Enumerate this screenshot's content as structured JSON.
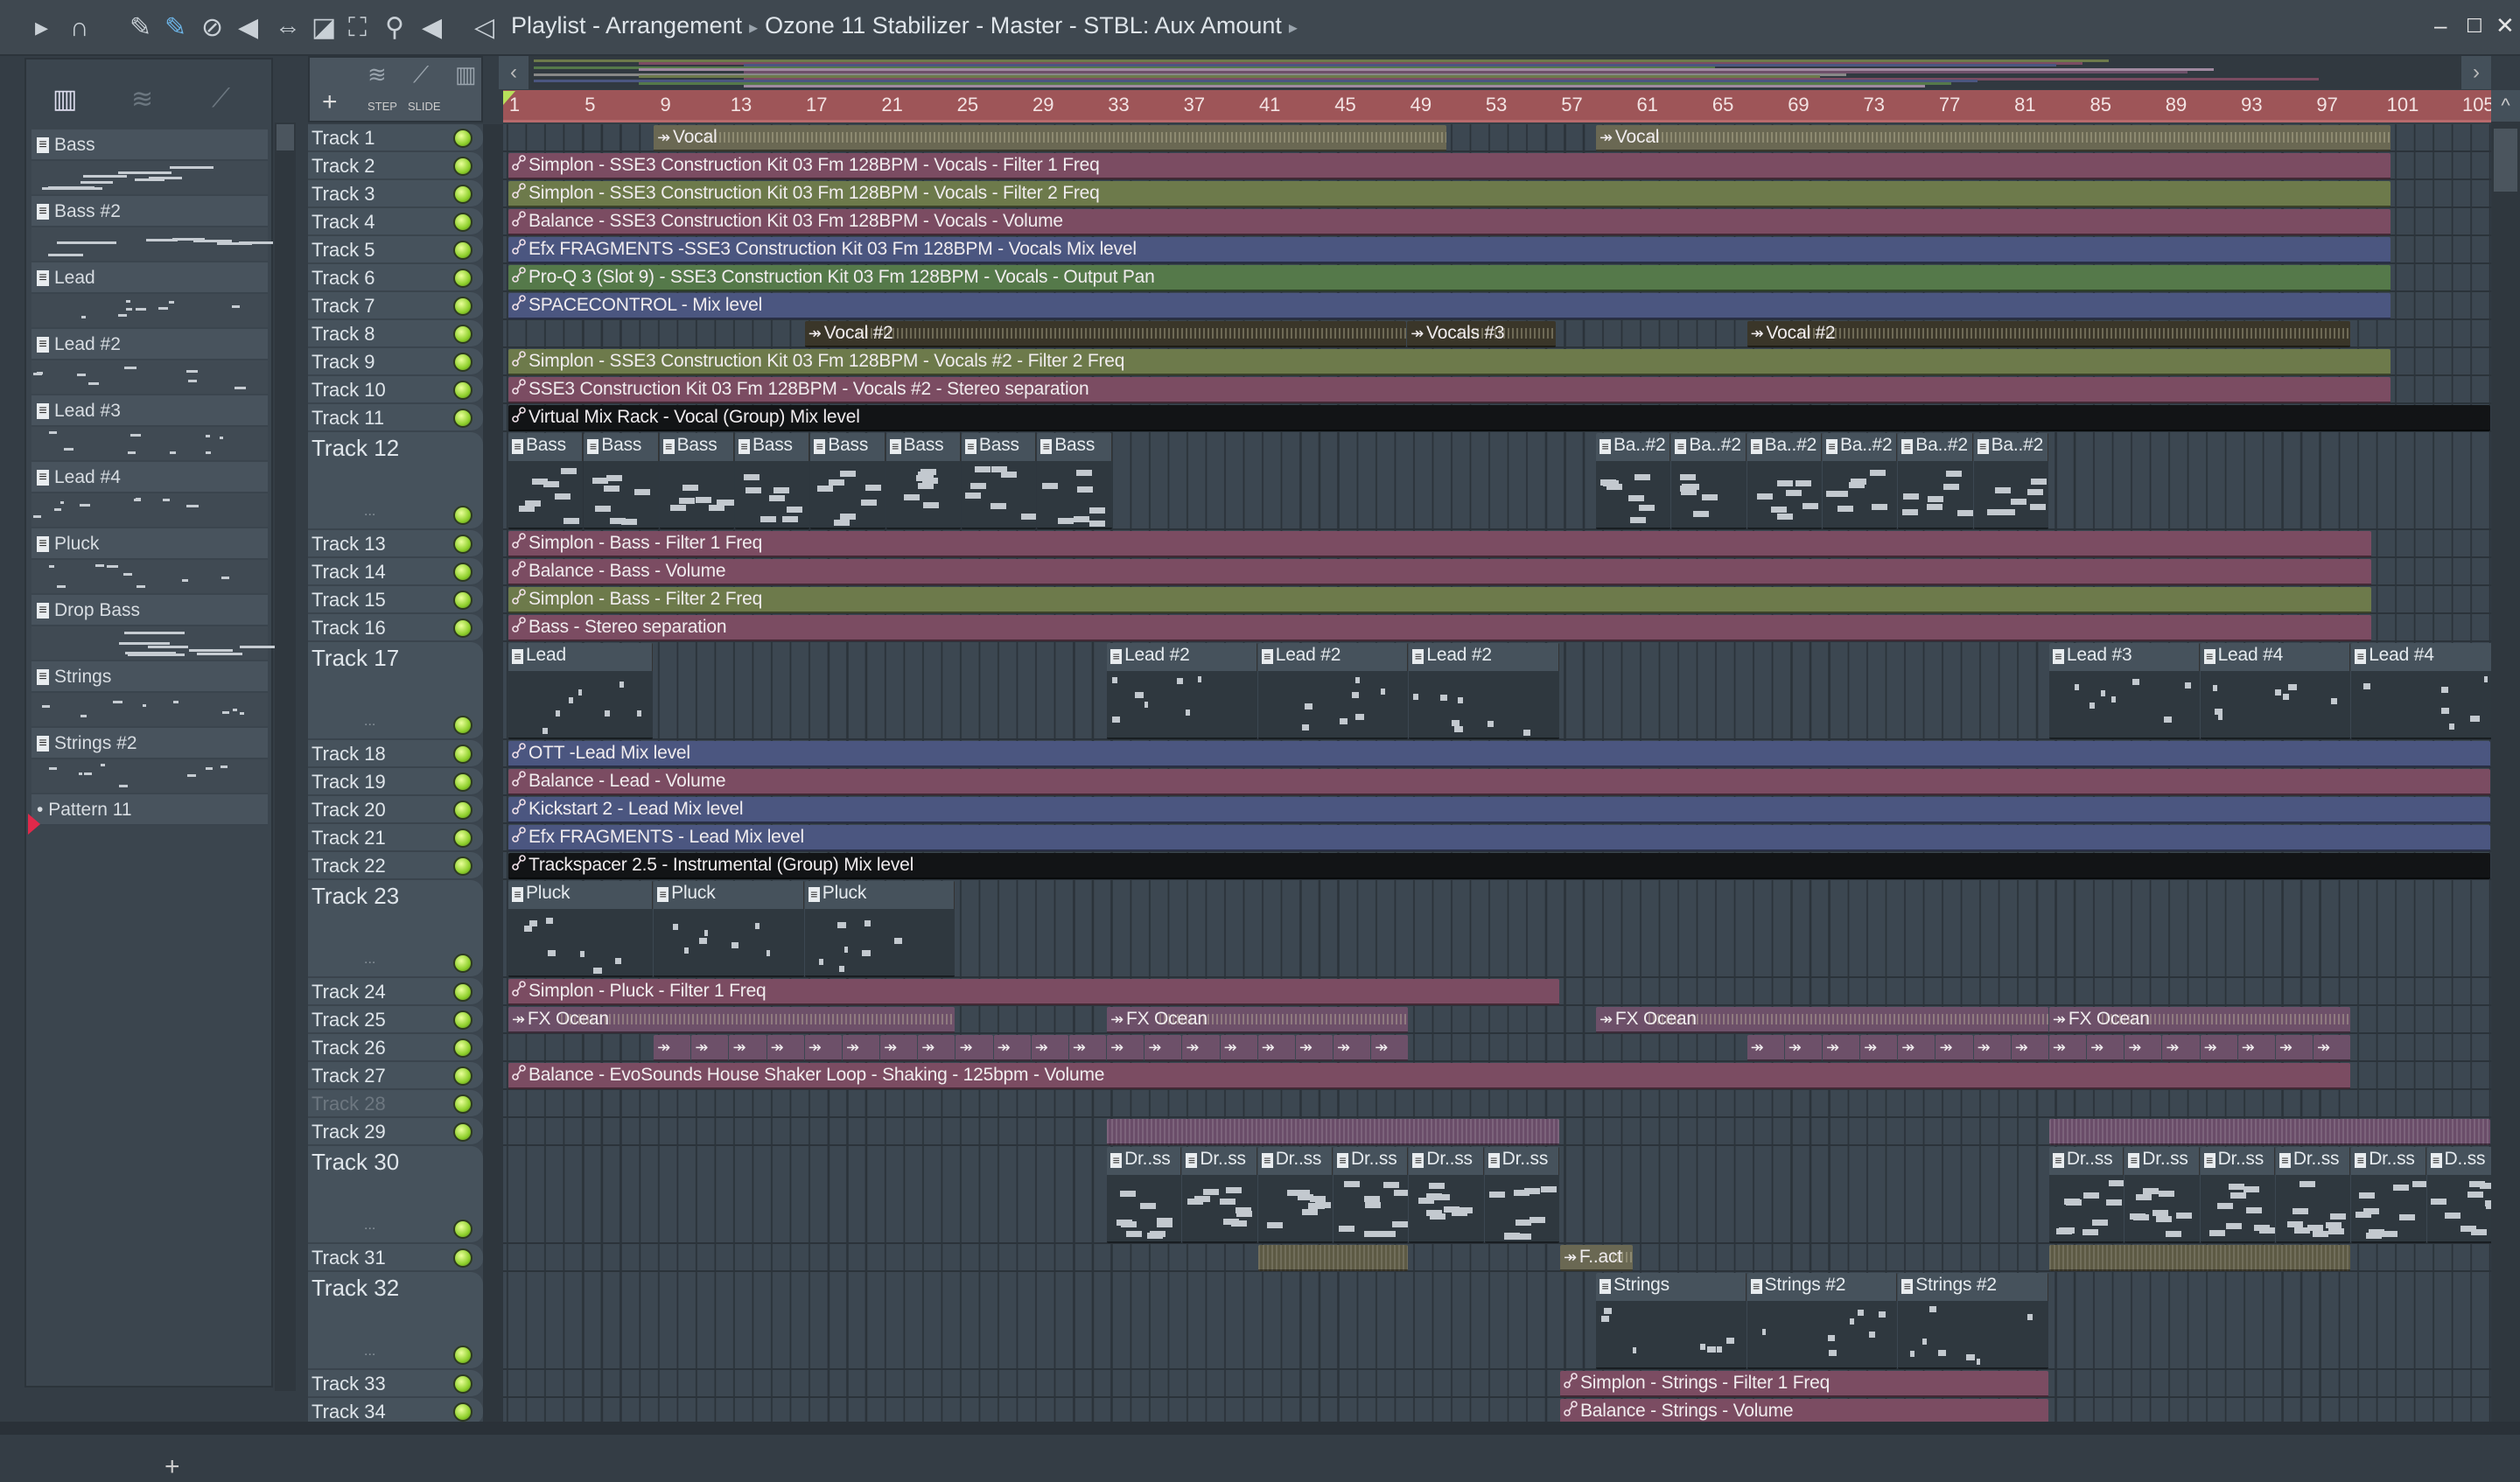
{
  "window": {
    "title": "Playlist - Arrangement",
    "breadcrumb": "Ozone 11 Stabilizer - Master - STBL: Aux Amount",
    "minimize": "‒",
    "maximize": "☐",
    "close": "✕"
  },
  "toolbar": {
    "icons": [
      {
        "name": "play-icon",
        "glyph": "▸"
      },
      {
        "name": "magnet-snap-icon",
        "glyph": "∩"
      },
      {
        "name": "pencil-draw-icon",
        "glyph": "✎"
      },
      {
        "name": "paint-brush-icon",
        "glyph": "✎"
      },
      {
        "name": "delete-icon",
        "glyph": "⊘"
      },
      {
        "name": "mute-icon",
        "glyph": "◀"
      },
      {
        "name": "slip-icon",
        "glyph": "⇔"
      },
      {
        "name": "slice-icon",
        "glyph": "◪"
      },
      {
        "name": "select-icon",
        "glyph": "⛶"
      },
      {
        "name": "zoom-icon",
        "glyph": "⚲"
      },
      {
        "name": "playback-icon",
        "glyph": "◀"
      },
      {
        "name": "speaker-icon",
        "glyph": "◁"
      }
    ]
  },
  "panel": {
    "add_label": "+",
    "step_label": "STEP",
    "slide_label": "SLIDE",
    "pattern_add_label": "+"
  },
  "patterns": [
    {
      "name": "Bass"
    },
    {
      "name": "Bass #2"
    },
    {
      "name": "Lead"
    },
    {
      "name": "Lead #2"
    },
    {
      "name": "Lead #3"
    },
    {
      "name": "Lead #4"
    },
    {
      "name": "Pluck"
    },
    {
      "name": "Drop Bass"
    },
    {
      "name": "Strings"
    },
    {
      "name": "Strings #2"
    },
    {
      "name": "Pattern 11",
      "current": true
    }
  ],
  "ruler": {
    "bars": [
      "1",
      "5",
      "9",
      "13",
      "17",
      "21",
      "25",
      "29",
      "33",
      "37",
      "41",
      "45",
      "49",
      "53",
      "57",
      "61",
      "65",
      "69",
      "73",
      "77",
      "81",
      "85",
      "89",
      "93",
      "97",
      "101",
      "105"
    ]
  },
  "colors": {
    "pink": "#7b4c62",
    "olive": "#6d7a4b",
    "blue": "#4b5680",
    "green": "#55794a",
    "black": "#121416",
    "vocal": "#6a6853",
    "vocaldark": "#3a3629",
    "fx": "#6d5069",
    "stripe": "#6a4d69",
    "ticks": "#5d5a44",
    "pattern": "#2f383f"
  },
  "tracks": [
    {
      "name": "Track 1",
      "clips": [
        {
          "s": 8.7,
          "e": 50.7,
          "kind": "audio",
          "color": "vocal",
          "label": "Vocal"
        },
        {
          "s": 58.6,
          "e": 100.7,
          "kind": "audio",
          "color": "vocal",
          "label": "Vocal"
        }
      ]
    },
    {
      "name": "Track 2",
      "clips": [
        {
          "s": 1,
          "e": 100.7,
          "kind": "auto",
          "color": "pink",
          "label": "Simplon - SSE3 Construction Kit 03 Fm 128BPM - Vocals - Filter 1 Freq"
        }
      ]
    },
    {
      "name": "Track 3",
      "clips": [
        {
          "s": 1,
          "e": 100.7,
          "kind": "auto",
          "color": "olive",
          "label": "Simplon - SSE3 Construction Kit 03 Fm 128BPM - Vocals - Filter 2 Freq"
        }
      ]
    },
    {
      "name": "Track 4",
      "clips": [
        {
          "s": 1,
          "e": 100.7,
          "kind": "auto",
          "color": "pink",
          "label": "Balance - SSE3 Construction Kit 03 Fm 128BPM - Vocals - Volume"
        }
      ]
    },
    {
      "name": "Track 5",
      "clips": [
        {
          "s": 1,
          "e": 100.7,
          "kind": "auto",
          "color": "blue",
          "label": "Efx FRAGMENTS -SSE3 Construction Kit 03 Fm 128BPM - Vocals Mix level"
        }
      ]
    },
    {
      "name": "Track 6",
      "clips": [
        {
          "s": 1,
          "e": 100.7,
          "kind": "auto",
          "color": "green",
          "label": "Pro-Q 3 (Slot 9) - SSE3 Construction Kit 03 Fm 128BPM - Vocals - Output Pan"
        }
      ]
    },
    {
      "name": "Track 7",
      "clips": [
        {
          "s": 1,
          "e": 100.7,
          "kind": "auto",
          "color": "blue",
          "label": "SPACECONTROL - Mix level"
        }
      ]
    },
    {
      "name": "Track 8",
      "clips": [
        {
          "s": 16.7,
          "e": 48.6,
          "kind": "audio",
          "color": "vocaldark",
          "label": "Vocal #2"
        },
        {
          "s": 48.6,
          "e": 56.5,
          "kind": "audio",
          "color": "vocaldark",
          "label": "Vocals #3"
        },
        {
          "s": 66.6,
          "e": 98.6,
          "kind": "audio",
          "color": "vocaldark",
          "label": "Vocal #2"
        }
      ]
    },
    {
      "name": "Track 9",
      "clips": [
        {
          "s": 1,
          "e": 100.7,
          "kind": "auto",
          "color": "olive",
          "label": "Simplon - SSE3 Construction Kit 03 Fm 128BPM - Vocals #2 - Filter 2 Freq"
        }
      ]
    },
    {
      "name": "Track 10",
      "clips": [
        {
          "s": 1,
          "e": 100.7,
          "kind": "auto",
          "color": "pink",
          "label": "SSE3 Construction Kit 03 Fm 128BPM - Vocals #2 - Stereo separation"
        }
      ]
    },
    {
      "name": "Track 11",
      "clips": [
        {
          "s": 1,
          "e": 106,
          "kind": "auto",
          "color": "black",
          "label": "Virtual Mix Rack - Vocal (Group) Mix level"
        }
      ]
    },
    {
      "name": "Track 12",
      "clips": [
        {
          "s": 1,
          "e": 5,
          "kind": "pattern",
          "label": "Bass"
        },
        {
          "s": 5,
          "e": 9,
          "kind": "pattern",
          "label": "Bass"
        },
        {
          "s": 9,
          "e": 13,
          "kind": "pattern",
          "label": "Bass"
        },
        {
          "s": 13,
          "e": 17,
          "kind": "pattern",
          "label": "Bass"
        },
        {
          "s": 17,
          "e": 21,
          "kind": "pattern",
          "label": "Bass"
        },
        {
          "s": 21,
          "e": 25,
          "kind": "pattern",
          "label": "Bass"
        },
        {
          "s": 25,
          "e": 29,
          "kind": "pattern",
          "label": "Bass"
        },
        {
          "s": 29,
          "e": 33,
          "kind": "pattern",
          "label": "Bass"
        },
        {
          "s": 58.6,
          "e": 62.6,
          "kind": "pattern",
          "label": "Ba..#2"
        },
        {
          "s": 62.6,
          "e": 66.6,
          "kind": "pattern",
          "label": "Ba..#2"
        },
        {
          "s": 66.6,
          "e": 70.6,
          "kind": "pattern",
          "label": "Ba..#2"
        },
        {
          "s": 70.6,
          "e": 74.6,
          "kind": "pattern",
          "label": "Ba..#2"
        },
        {
          "s": 74.6,
          "e": 78.6,
          "kind": "pattern",
          "label": "Ba..#2"
        },
        {
          "s": 78.6,
          "e": 82.6,
          "kind": "pattern",
          "label": "Ba..#2"
        }
      ]
    },
    {
      "name": "Track 13",
      "clips": [
        {
          "s": 1,
          "e": 99.7,
          "kind": "auto",
          "color": "pink",
          "label": "Simplon - Bass - Filter 1 Freq"
        }
      ]
    },
    {
      "name": "Track 14",
      "clips": [
        {
          "s": 1,
          "e": 99.7,
          "kind": "auto",
          "color": "pink",
          "label": "Balance - Bass - Volume"
        }
      ]
    },
    {
      "name": "Track 15",
      "clips": [
        {
          "s": 1,
          "e": 99.7,
          "kind": "auto",
          "color": "olive",
          "label": "Simplon - Bass - Filter 2 Freq"
        }
      ]
    },
    {
      "name": "Track 16",
      "clips": [
        {
          "s": 1,
          "e": 99.7,
          "kind": "auto",
          "color": "pink",
          "label": "Bass - Stereo separation"
        }
      ]
    },
    {
      "name": "Track 17",
      "clips": [
        {
          "s": 1,
          "e": 8.7,
          "kind": "pattern",
          "label": "Lead"
        },
        {
          "s": 32.7,
          "e": 40.7,
          "kind": "pattern",
          "label": "Lead #2"
        },
        {
          "s": 40.7,
          "e": 48.7,
          "kind": "pattern",
          "label": "Lead #2"
        },
        {
          "s": 48.7,
          "e": 56.7,
          "kind": "pattern",
          "label": "Lead #2"
        },
        {
          "s": 82.6,
          "e": 90.6,
          "kind": "pattern",
          "label": "Lead #3"
        },
        {
          "s": 90.6,
          "e": 98.6,
          "kind": "pattern",
          "label": "Lead #4"
        },
        {
          "s": 98.6,
          "e": 106.6,
          "kind": "pattern",
          "label": "Lead #4"
        }
      ]
    },
    {
      "name": "Track 18",
      "clips": [
        {
          "s": 1,
          "e": 106,
          "kind": "auto",
          "color": "blue",
          "label": "OTT -Lead Mix level"
        }
      ]
    },
    {
      "name": "Track 19",
      "clips": [
        {
          "s": 1,
          "e": 106,
          "kind": "auto",
          "color": "pink",
          "label": "Balance - Lead - Volume"
        }
      ]
    },
    {
      "name": "Track 20",
      "clips": [
        {
          "s": 1,
          "e": 106,
          "kind": "auto",
          "color": "blue",
          "label": "Kickstart 2 - Lead Mix level"
        }
      ]
    },
    {
      "name": "Track 21",
      "clips": [
        {
          "s": 1,
          "e": 106,
          "kind": "auto",
          "color": "blue",
          "label": "Efx FRAGMENTS - Lead Mix level"
        }
      ]
    },
    {
      "name": "Track 22",
      "clips": [
        {
          "s": 1,
          "e": 106,
          "kind": "auto",
          "color": "black",
          "label": "Trackspacer 2.5 - Instrumental (Group) Mix level"
        }
      ]
    },
    {
      "name": "Track 23",
      "clips": [
        {
          "s": 1,
          "e": 8.7,
          "kind": "pattern",
          "label": "Pluck"
        },
        {
          "s": 8.7,
          "e": 16.7,
          "kind": "pattern",
          "label": "Pluck"
        },
        {
          "s": 16.7,
          "e": 24.7,
          "kind": "pattern",
          "label": "Pluck"
        }
      ]
    },
    {
      "name": "Track 24",
      "clips": [
        {
          "s": 1,
          "e": 56.7,
          "kind": "auto",
          "color": "pink",
          "label": "Simplon - Pluck - Filter 1 Freq"
        }
      ]
    },
    {
      "name": "Track 25",
      "clips": [
        {
          "s": 1,
          "e": 24.7,
          "kind": "audio",
          "color": "fx",
          "label": "FX Ocean"
        },
        {
          "s": 32.7,
          "e": 48.7,
          "kind": "audio",
          "color": "fx",
          "label": "FX Ocean"
        },
        {
          "s": 58.6,
          "e": 82.6,
          "kind": "audio",
          "color": "fx",
          "label": "FX Ocean"
        },
        {
          "s": 82.6,
          "e": 98.6,
          "kind": "audio",
          "color": "fx",
          "label": "FX Ocean"
        }
      ]
    },
    {
      "name": "Track 26",
      "repeats": [
        {
          "s": 8.7,
          "len": 2,
          "count": 20,
          "kind": "audio",
          "color": "fx"
        },
        {
          "s": 66.6,
          "len": 2,
          "count": 16,
          "kind": "audio",
          "color": "fx"
        }
      ]
    },
    {
      "name": "Track 27",
      "clips": [
        {
          "s": 1,
          "e": 98.6,
          "kind": "auto",
          "color": "pink",
          "label": "Balance - EvoSounds House Shaker Loop - Shaking - 125bpm - Volume"
        }
      ]
    },
    {
      "name": "Track 28",
      "disabled": true,
      "clips": []
    },
    {
      "name": "Track 29",
      "clips": [
        {
          "s": 32.7,
          "e": 56.7,
          "kind": "stripes",
          "color": "stripe",
          "label": ""
        },
        {
          "s": 82.6,
          "e": 106,
          "kind": "stripes",
          "color": "stripe",
          "label": ""
        }
      ]
    },
    {
      "name": "Track 30",
      "clips": [
        {
          "s": 32.7,
          "e": 36.7,
          "kind": "drum",
          "label": "Dr..ss"
        },
        {
          "s": 36.7,
          "e": 40.7,
          "kind": "drum",
          "label": "Dr..ss"
        },
        {
          "s": 40.7,
          "e": 44.7,
          "kind": "drum",
          "label": "Dr..ss"
        },
        {
          "s": 44.7,
          "e": 48.7,
          "kind": "drum",
          "label": "Dr..ss"
        },
        {
          "s": 48.7,
          "e": 52.7,
          "kind": "drum",
          "label": "Dr..ss"
        },
        {
          "s": 52.7,
          "e": 56.7,
          "kind": "drum",
          "label": "Dr..ss"
        },
        {
          "s": 82.6,
          "e": 86.6,
          "kind": "drum",
          "label": "Dr..ss"
        },
        {
          "s": 86.6,
          "e": 90.6,
          "kind": "drum",
          "label": "Dr..ss"
        },
        {
          "s": 90.6,
          "e": 94.6,
          "kind": "drum",
          "label": "Dr..ss"
        },
        {
          "s": 94.6,
          "e": 98.6,
          "kind": "drum",
          "label": "Dr..ss"
        },
        {
          "s": 98.6,
          "e": 102.6,
          "kind": "drum",
          "label": "Dr..ss"
        },
        {
          "s": 102.6,
          "e": 106.6,
          "kind": "drum",
          "label": "D..ss"
        }
      ]
    },
    {
      "name": "Track 31",
      "clips": [
        {
          "s": 40.7,
          "e": 48.7,
          "kind": "stripes",
          "color": "ticks",
          "label": ""
        },
        {
          "s": 56.7,
          "e": 60.6,
          "kind": "audio",
          "color": "vocal",
          "label": "F..act"
        },
        {
          "s": 82.6,
          "e": 98.6,
          "kind": "stripes",
          "color": "ticks",
          "label": ""
        }
      ]
    },
    {
      "name": "Track 32",
      "clips": [
        {
          "s": 58.6,
          "e": 66.6,
          "kind": "pattern",
          "label": "Strings"
        },
        {
          "s": 66.6,
          "e": 74.6,
          "kind": "pattern",
          "label": "Strings #2"
        },
        {
          "s": 74.6,
          "e": 82.6,
          "kind": "pattern",
          "label": "Strings #2"
        }
      ]
    },
    {
      "name": "Track 33",
      "clips": [
        {
          "s": 56.7,
          "e": 82.6,
          "kind": "auto",
          "color": "pink",
          "label": "Simplon - Strings - Filter 1 Freq"
        }
      ]
    },
    {
      "name": "Track 34",
      "clips": [
        {
          "s": 56.7,
          "e": 82.6,
          "kind": "auto",
          "color": "pink",
          "label": "Balance - Strings - Volume"
        }
      ]
    }
  ]
}
